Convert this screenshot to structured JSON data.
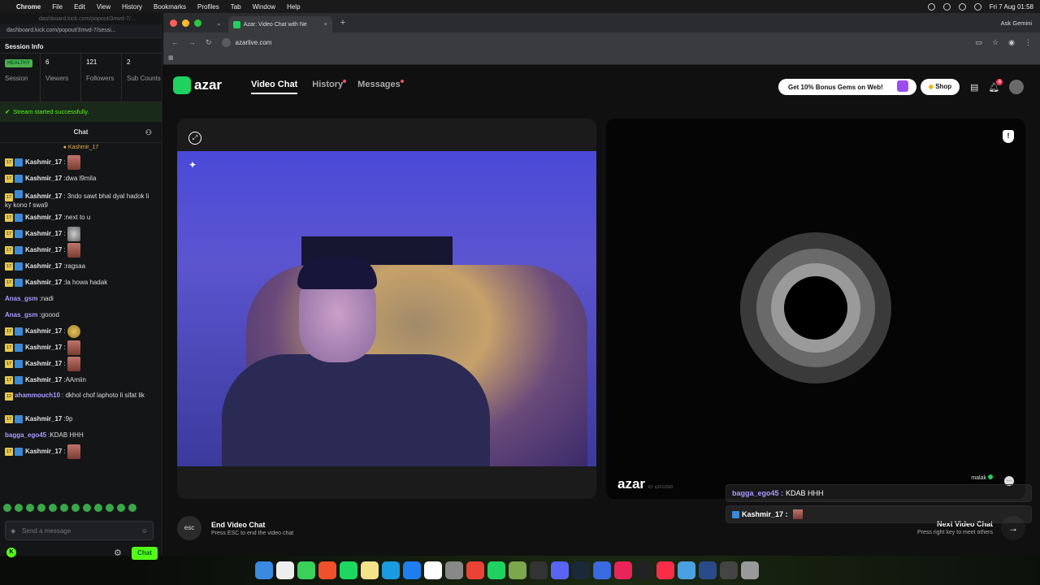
{
  "menubar": {
    "app": "Chrome",
    "items": [
      "File",
      "Edit",
      "View",
      "History",
      "Bookmarks",
      "Profiles",
      "Tab",
      "Window",
      "Help"
    ],
    "clock": "Fri 7 Aug  01:58"
  },
  "kick": {
    "faded_url": "dashboard.kick.com/popout/3mvd-7/...",
    "url": "dashboard.kick.com/popout/3mvd-7/sessi...",
    "session_title": "Session Info",
    "stats": [
      {
        "value": "HEALTHY",
        "label": "Session"
      },
      {
        "value": "6",
        "label": "Viewers"
      },
      {
        "value": "121",
        "label": "Followers"
      },
      {
        "value": "2",
        "label": "Sub Counts"
      }
    ],
    "notice": "Stream started successfully.",
    "chat_title": "Chat",
    "pinned": "Kashmir_17",
    "messages": [
      {
        "user": "Kashmir_17",
        "text": "",
        "emote": "face",
        "sub": "17",
        "kick": true
      },
      {
        "user": "Kashmir_17",
        "text": "dwa l9mila",
        "sub": "17",
        "kick": true
      },
      {
        "user": "Kashmir_17",
        "text": "3ndo sawt bhal dyal hadok li ky kono f swa9",
        "sub": "17",
        "kick": true,
        "wrap": true
      },
      {
        "user": "Kashmir_17",
        "text": "next to u",
        "sub": "17",
        "kick": true
      },
      {
        "user": "Kashmir_17",
        "text": "",
        "emote": "gray",
        "sub": "17",
        "kick": true
      },
      {
        "user": "Kashmir_17",
        "text": "",
        "emote": "face",
        "sub": "17",
        "kick": true
      },
      {
        "user": "Kashmir_17",
        "text": "ragsaa",
        "sub": "17",
        "kick": true
      },
      {
        "user": "Kashmir_17",
        "text": "la howa hadak",
        "sub": "17",
        "kick": true
      },
      {
        "user": "Anas_gsm",
        "text": "nadi",
        "purple": true
      },
      {
        "user": "Anas_gsm",
        "text": "goood",
        "purple": true
      },
      {
        "user": "Kashmir_17",
        "text": "",
        "emote": "cat",
        "sub": "17",
        "kick": true
      },
      {
        "user": "Kashmir_17",
        "text": "",
        "emote": "face",
        "sub": "17",
        "kick": true
      },
      {
        "user": "Kashmir_17",
        "text": "",
        "emote": "face",
        "sub": "17",
        "kick": true
      },
      {
        "user": "Kashmir_17",
        "text": "AAmiin",
        "sub": "17",
        "kick": true
      },
      {
        "user": "ahammouch10",
        "text": "dkhol chof laphoto li sifat lik",
        "sub": "12",
        "purple": true,
        "wrap": true
      },
      {
        "user": "Kashmir_17",
        "text": "9p",
        "sub": "17",
        "kick": true
      },
      {
        "user": "bagga_ego45",
        "text": "KDAB HHH",
        "purple": true
      },
      {
        "user": "Kashmir_17",
        "text": "",
        "emote": "face",
        "sub": "17",
        "kick": true
      }
    ],
    "input_placeholder": "Send a message",
    "chat_button": "Chat"
  },
  "browser": {
    "tab_title": "Azar: Video Chat with Ne",
    "url": "azarlive.com",
    "ask_gemini": "Ask Gemini"
  },
  "azar": {
    "logo": "azar",
    "nav": [
      "Video Chat",
      "History",
      "Messages"
    ],
    "promo": "Get 10% Bonus Gems on Web!",
    "shop": "Shop",
    "notif_count": "4",
    "watermark": "azar",
    "watermark_id": "ID: q1F10560",
    "peer_name": "malak",
    "end_title": "End Video Chat",
    "end_sub": "Press ESC to end the video chat",
    "esc": "esc",
    "next_title": "Next Video Chat",
    "next_sub": "Press right key to meet others",
    "overlay": [
      {
        "user": "bagga_ego45 :",
        "text": "KDAB HHH"
      },
      {
        "user": "Kashmir_17 :",
        "text": ""
      }
    ]
  },
  "colors": {
    "kick_green": "#53fc18",
    "azar_green": "#1fd15e",
    "accent_purple": "#a99bff"
  }
}
